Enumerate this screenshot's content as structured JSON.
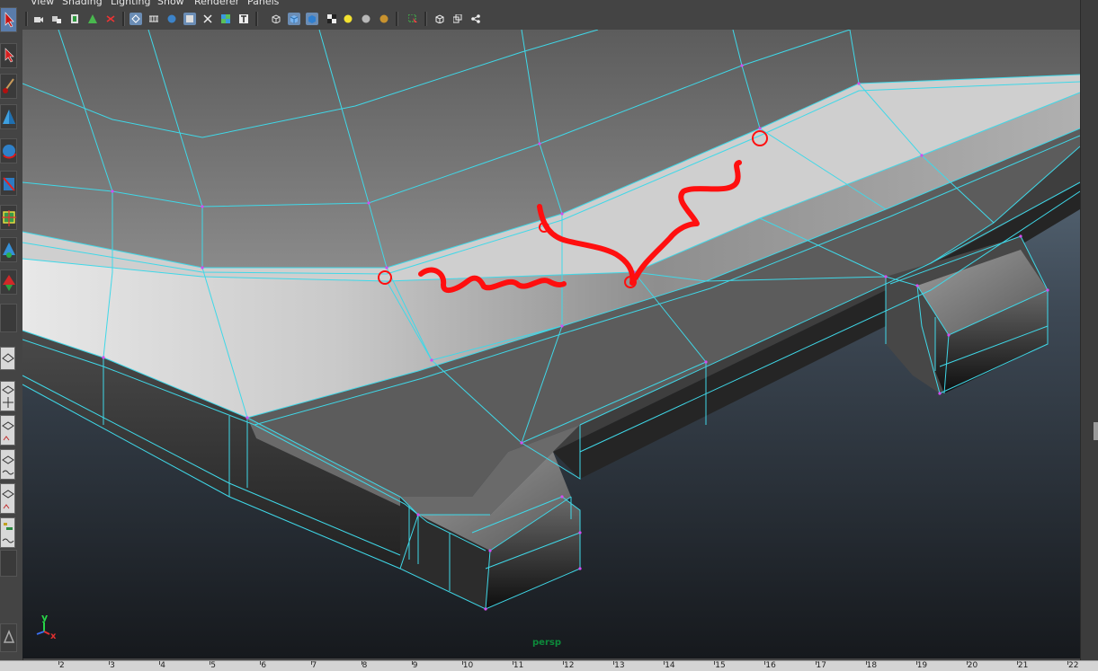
{
  "menu": {
    "items": [
      "View",
      "Shading",
      "Lighting",
      "Show",
      "Renderer",
      "Panels"
    ]
  },
  "viewport": {
    "camera_label": "persp",
    "axis": {
      "x": "x",
      "y": "y"
    },
    "wire_color": "#3fd8e8",
    "vertex_color": "#d24cf0",
    "annotation_color": "#ff0f0f"
  },
  "timeline": {
    "ticks": [
      "2",
      "3",
      "4",
      "5",
      "6",
      "7",
      "8",
      "9",
      "10",
      "11",
      "12",
      "13",
      "14",
      "15",
      "16",
      "17",
      "18",
      "19",
      "20",
      "21",
      "22"
    ]
  }
}
